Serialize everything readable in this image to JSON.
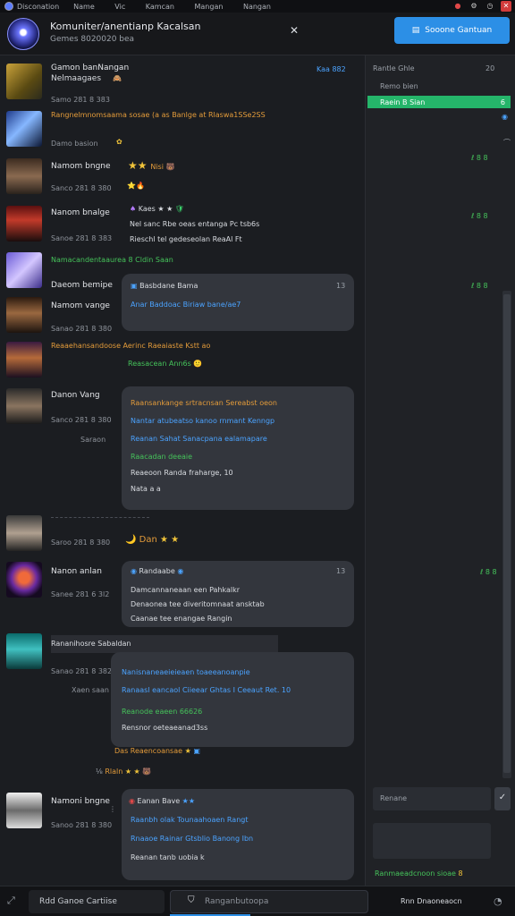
{
  "topbar": {
    "app": "Disconation",
    "menu": [
      "Name",
      "Vic",
      "Kamcan",
      "Mangan",
      "Nangan"
    ]
  },
  "header": {
    "title": "Komuniter/anentianp Kacalsan",
    "subtitle": "Gemes 8020020 bea",
    "cta": "Sooone Gantuan"
  },
  "messages": [
    {
      "name": "Gamon banNangan",
      "sub": "Nelmaagaes",
      "meta": "Samo 281 8 383",
      "badge": "Kaa 882",
      "line": "Rangnelmnomsaama sosae (a as Banlge at Rlaswa1SSe2SS",
      "lineColor": "orange"
    },
    {
      "name": "Danos basion",
      "meta": "Damo basion"
    },
    {
      "name": "Namom bngne",
      "meta": "Sanco 281 8 380"
    },
    {
      "name": "Nanom bnalge",
      "tag": "Kaes",
      "meta": "Sanoe 281 8 383",
      "l1": "Nel sanc Rbe oeas entanga Pc tsb6s",
      "l2": "Rieschl tel gedeseolan ReaAl Ft",
      "l3": "Namacandentaaurea 8 Cldin   Saan",
      "l3b": "Saan"
    },
    {
      "name": "Daeom bemipe",
      "meta": "Namom vange",
      "meta2": "Sanao 281 8 380",
      "line": "Reaaehansandoose Aerinc Raeaiaste Kstt ao",
      "bubbleName": "Basbdane Bama",
      "bubbleText": "Anar Baddoac Biriaw bane/ae7"
    },
    {
      "name": "Danon Vang",
      "meta": "Sanco 281 8 380",
      "meta2": "Saraon",
      "l1": "Raansankange srtracnsan Sereabst oeon",
      "l2": "Nantar atubeatso kanoo rnmant Kenngp",
      "l3": "Reanan Sahat Sanacpana ealamapare",
      "l4": "Raacadan deeaie",
      "l5": "Reaeoon Randa fraharge, 10",
      "l6": "Nata a a"
    },
    {
      "name": "",
      "meta": "Saroo 281 8 380",
      "inline": "Dan"
    },
    {
      "name": "Nanon anlan",
      "meta": "Sanee 281 6 3l2",
      "bubbleName": "Randaabe",
      "b1": "Damcannaneaan een Pahkalkr",
      "b2": "Denaonea tee diveritomnaat ansktab",
      "b3": "Caanae tee enangae Rangin"
    },
    {
      "name": "Rananihosre Sabaldan",
      "meta": "Sanao 281 8 382",
      "meta2": "Xaen saan",
      "b1": "Nanisnaneaeieieaen toaeeanoanpie",
      "b2": "Ranaasl eancaol Ciieear Ghtas I Ceeaut Ret. 10",
      "b3": "Reanode eaeen 66626",
      "b4": "Rensnor oeteaeanad3ss",
      "after1": "Das Reaencoansae",
      "after2": "Rlaln"
    },
    {
      "name": "Namoni bngne",
      "meta": "Sanoo 281 8 380",
      "bubbleName": "Eanan Bave",
      "b1": "Raanbh olak Tounaahoaen Rangt",
      "b2": "Rnaaoe Rainar Gtsblio Banong Ibn",
      "b3": "Reanan tanb uobia k"
    }
  ],
  "sidebar": {
    "header": "Rantle Ghle",
    "selected": "Raein B Sian",
    "rows": [
      "Remo bien"
    ],
    "input_placeholder": "Renane",
    "footer": "Ranmaeadcnoon sioae"
  },
  "bottom": {
    "left": "Rdd Ganoe Cartiise",
    "search_placeholder": "Ranganbutoopa",
    "right": "Rnn Dnaoneaocn"
  }
}
